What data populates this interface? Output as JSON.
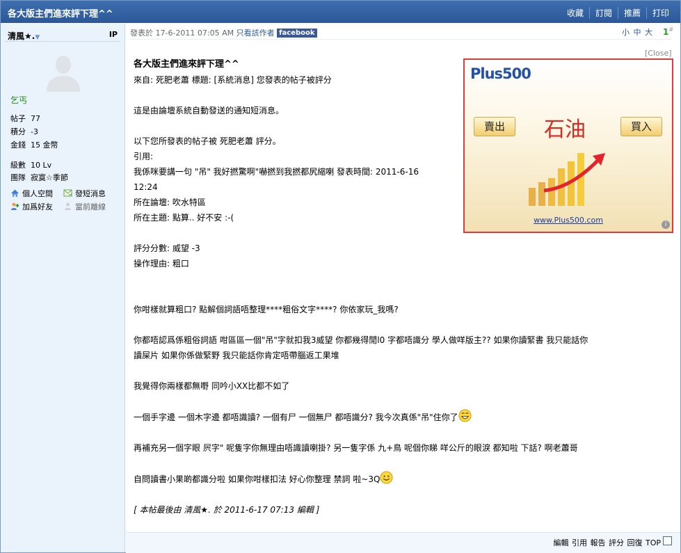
{
  "titlebar": {
    "title": "各大版主們進來評下理^^",
    "actions": [
      "收藏",
      "訂閱",
      "推薦",
      "打印"
    ]
  },
  "sidebar": {
    "username": "清風★.",
    "ip_label": "IP",
    "rank": "乞丐",
    "stats": [
      {
        "label": "帖子",
        "value": "77"
      },
      {
        "label": "積分",
        "value": "-3"
      },
      {
        "label": "金錢",
        "value": "15 金幣"
      }
    ],
    "stats2": [
      {
        "label": "級數",
        "value": "10 Lv"
      },
      {
        "label": "團隊",
        "value": "寂寞☆季節"
      }
    ],
    "buttons": {
      "space": "個人空間",
      "message": "發短消息",
      "add_friend": "加爲好友",
      "offline": "當前離線"
    }
  },
  "post": {
    "meta_prefix": "發表於 17-6-2011 07:05 AM",
    "author_only": "只看該作者",
    "facebook": "facebook",
    "font_sizes": "小 中 大",
    "floor": "1",
    "floor_mark": "#",
    "title": "各大版主們進來評下理^^",
    "lines": {
      "l1": "來自: 死肥老蕭  標題: [系統消息] 您發表的帖子被評分",
      "l2": "這是由論壇系統自動發送的通知短消息。",
      "l3": "以下您所發表的帖子被 死肥老蕭 評分。",
      "l4": "引用:",
      "l5": "我係咪要講一句  \"吊\" 我好撚驚啊\"嚇撚到我撚都尻縮喇 發表時間: 2011-6-16",
      "l6": "12:24",
      "l7": "所在論壇: 吹水特區",
      "l8": "所在主題: 點算.. 好不安 :-(",
      "l9": "評分分數: 威望 -3",
      "l10": "操作理由: 粗口",
      "l11": "你咁樣就算粗口?  點解個詞語唔整理****粗俗文字****?  你依家玩_我嗎?",
      "l12": "你都唔認爲係粗俗詞語 咁區區一個\"吊\"字就扣我3威望  你都幾得閒l0    字都唔識分 學人做咩版主?? 如果你讀緊書 我只能話你",
      "l13": "讀屎片  如果你係做緊野 我只能話你肯定唔帶腦返工果堆",
      "l14": "我覺得你兩樣都無嘢  同吟小XX比都不如了",
      "l15": "一個手字邊   一個木字邊 都唔識讀?    一個有尸  一個無尸 都唔識分? 我今次真係\"吊\"住你了",
      "l16": "再補充另一個字眼  屄字\"  呢隻字你無理由唔識讀喇掛?  另一隻字係 九+鳥  呢個你睇 咩公斤的眼淚 都知啦 下話? 啊老蕭哥",
      "l17": "自問讀書小果啲都識分啦  如果你咁樣扣法 好心你整理 禁詞 啦~3Q",
      "edit": "[ 本帖最後由 清風★. 於 2011-6-17 07:13 編輯 ]"
    }
  },
  "ad": {
    "close": "[Close]",
    "logo": "Plus500",
    "sell": "賣出",
    "buy": "買入",
    "commodity": "石油",
    "url": "www.Plus500.com",
    "info": "i"
  },
  "footer": {
    "links": "編輯 引用 報告 評分 回復 TOP"
  }
}
